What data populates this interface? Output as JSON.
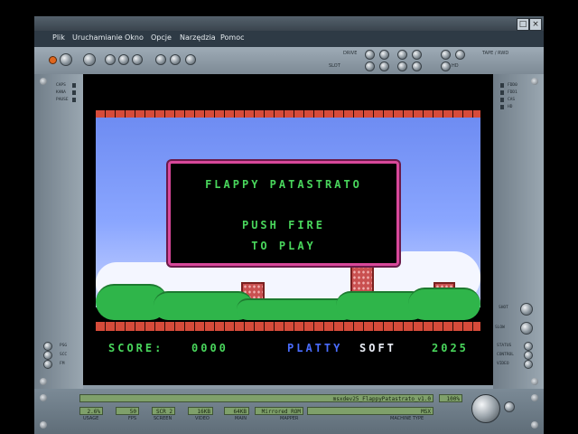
{
  "window": {
    "close_glyph": "×",
    "max_glyph": "□"
  },
  "menu": [
    "Plik",
    "Uruchamianie",
    "Okno",
    "Opcje",
    "Narzędzia",
    "Pomoc"
  ],
  "toolbar": {
    "drive_label": "DRIVE",
    "slot_label": "SLOT",
    "tape_label": "TAPE / RWD",
    "hd_label": "HD"
  },
  "left_leds": [
    "CAPS",
    "KANA",
    "PAUSE"
  ],
  "right_leds": [
    "FDD0",
    "FDD1",
    "CAS",
    "HD"
  ],
  "left_bottom_labels": [
    "PSG",
    "SCC",
    "FM"
  ],
  "right_bottom_labels": [
    "SHOT",
    "SLOW",
    "STATUS",
    "CONTROL",
    "VIDEO"
  ],
  "game": {
    "title": "FLAPPY PATASTRATO",
    "line1": "PUSH FIRE",
    "line2": "TO PLAY",
    "score_label": "SCORE:",
    "score_value": "0000",
    "brand_blue": "PLATTY",
    "brand_white": "SOFT",
    "year": "2025"
  },
  "status": {
    "file": "msxdev25_FlappyPatastrato_v1.0",
    "volume_value": "100%",
    "usage": {
      "label": "USAGE",
      "value": "2.6%"
    },
    "fps": {
      "label": "FPS",
      "value": "50"
    },
    "screen": {
      "label": "SCREEN",
      "value": "SCR 2"
    },
    "video": {
      "label": "VIDEO",
      "value": "16KB"
    },
    "main": {
      "label": "MAIN",
      "value": "64KB"
    },
    "mapper": {
      "label": "MAPPER",
      "value": "Mirrored ROM"
    },
    "machine": {
      "label": "MACHINE TYPE",
      "value": "MSX"
    }
  },
  "colors": {
    "lcd": "#7fa06a",
    "game_text": "#49d65c",
    "dialog_border": "#d8489a",
    "brand_blue": "#4a6cff"
  }
}
